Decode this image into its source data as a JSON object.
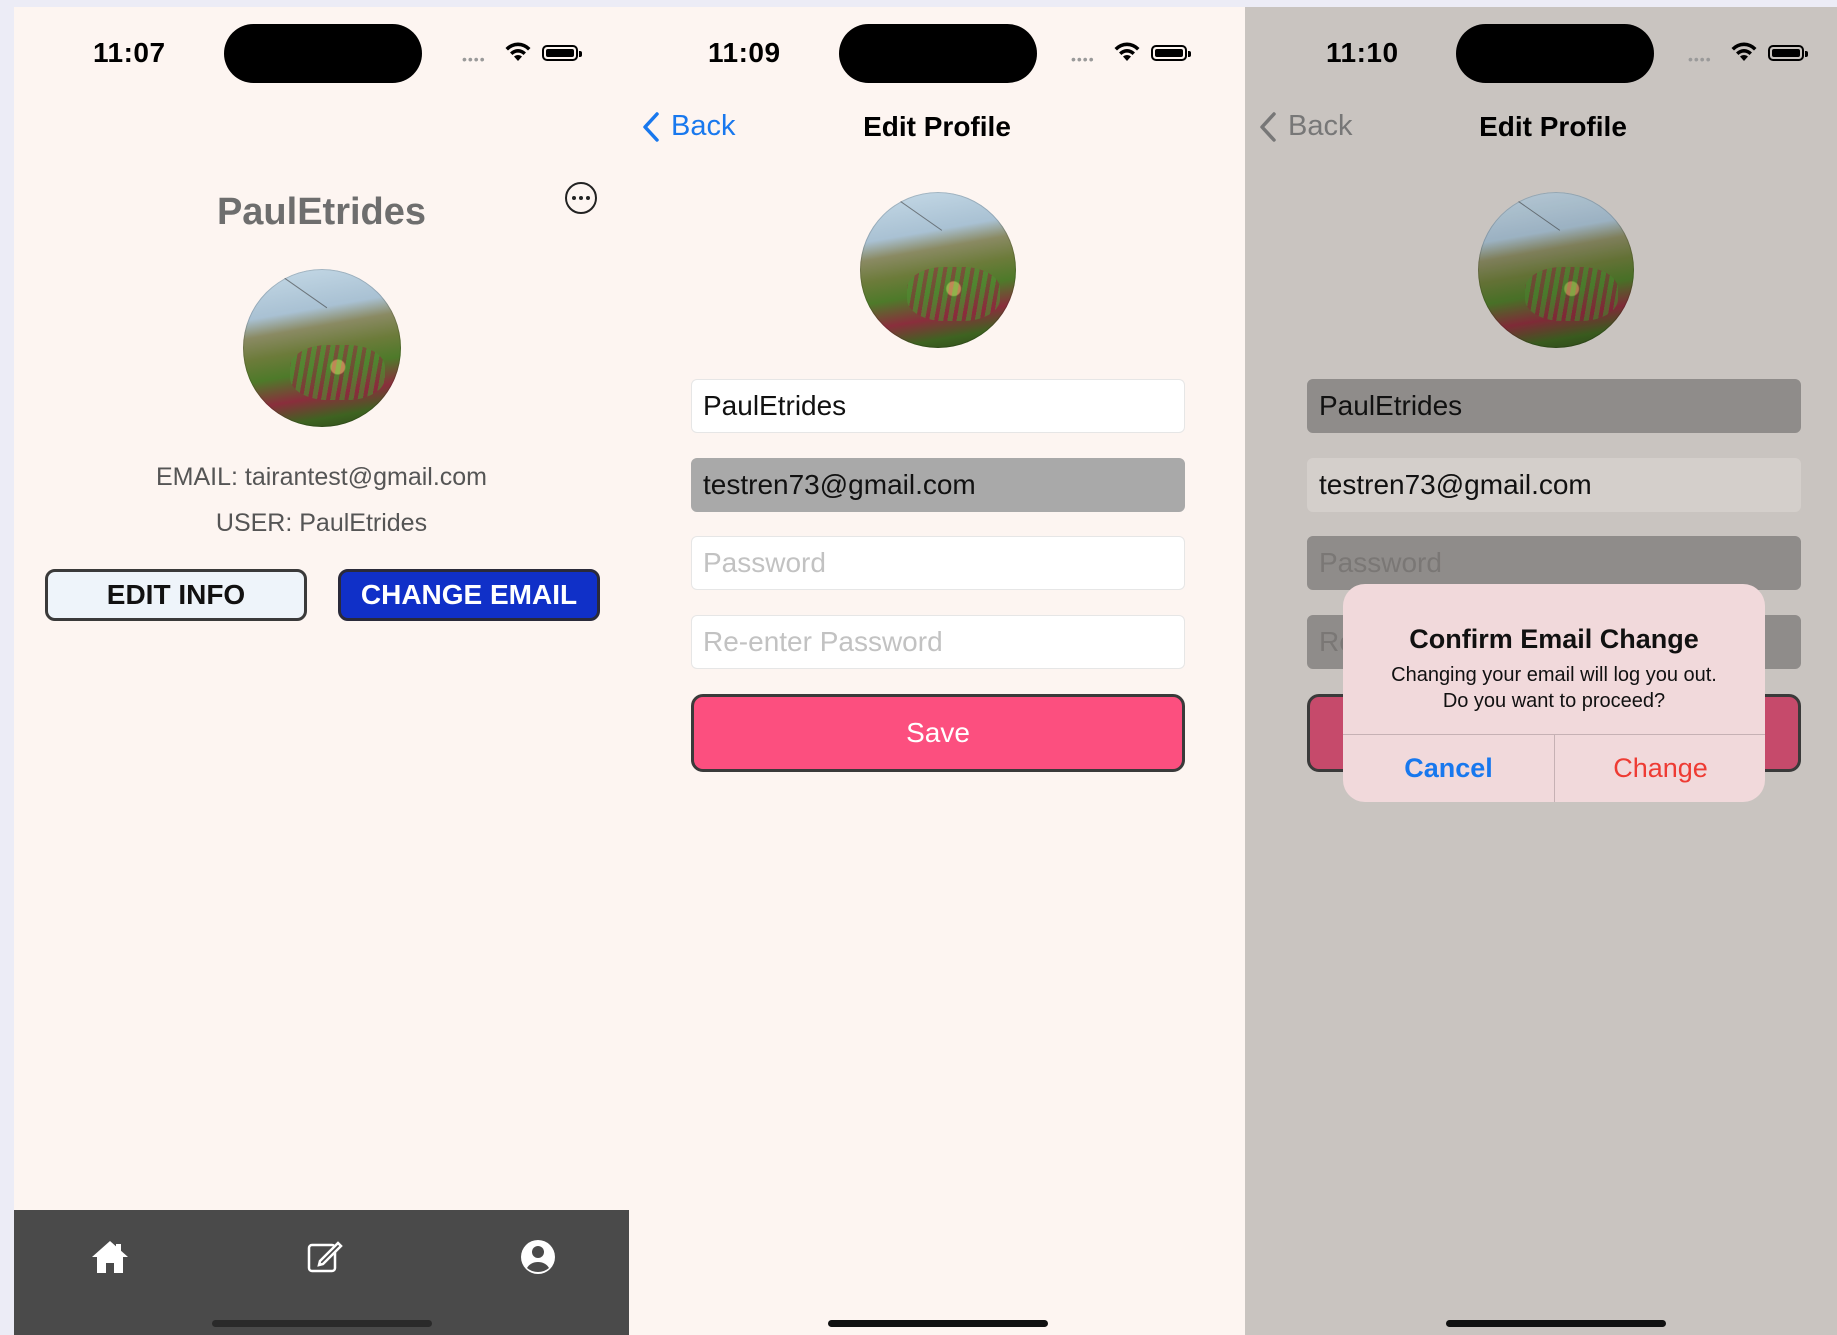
{
  "screen1": {
    "time": "11:07",
    "username": "PaulEtrides",
    "email_line": "EMAIL: tairantest@gmail.com",
    "user_line": "USER: PaulEtrides",
    "edit_button": "EDIT INFO",
    "change_email_button": "CHANGE EMAIL",
    "tabs": [
      {
        "icon": "home-icon"
      },
      {
        "icon": "compose-icon"
      },
      {
        "icon": "profile-icon"
      }
    ]
  },
  "screen2": {
    "time": "11:09",
    "back_label": "Back",
    "title": "Edit Profile",
    "username_value": "PaulEtrides",
    "email_value": "testren73@gmail.com",
    "password_placeholder": "Password",
    "reenter_placeholder": "Re-enter Password",
    "save_label": "Save"
  },
  "screen3": {
    "time": "11:10",
    "back_label": "Back",
    "title": "Edit Profile",
    "username_value": "PaulEtrides",
    "email_value": "testren73@gmail.com",
    "password_placeholder": "Password",
    "reenter_partial": "Re",
    "dialog": {
      "title": "Confirm Email Change",
      "message_line1": "Changing your email will log you out.",
      "message_line2": "Do you want to proceed?",
      "cancel_label": "Cancel",
      "change_label": "Change"
    }
  },
  "colors": {
    "accent_blue": "#1878ee",
    "change_email_blue": "#1030c8",
    "save_pink": "#fc4f7f",
    "destructive_red": "#ee3b33",
    "tabbar_gray": "#4a4a4a"
  }
}
